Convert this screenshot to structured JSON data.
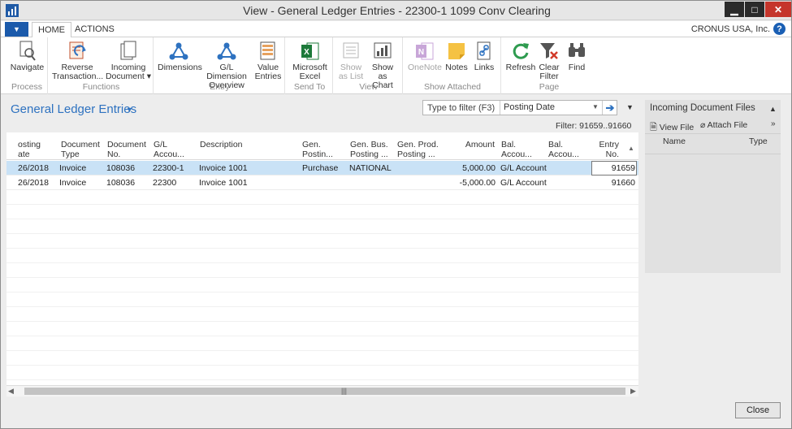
{
  "window": {
    "title": "View - General Ledger Entries - 22300-1 1099 Conv Clearing"
  },
  "tabs": [
    {
      "label": "HOME"
    },
    {
      "label": "ACTIONS"
    }
  ],
  "company": "CRONUS USA, Inc.",
  "ribbon": {
    "groups": [
      {
        "label": "Process",
        "buttons": [
          {
            "label1": "Navigate",
            "label2": "",
            "icon": "navigate-icon"
          }
        ]
      },
      {
        "label": "Functions",
        "buttons": [
          {
            "label1": "Reverse",
            "label2": "Transaction...",
            "icon": "reverse-transaction-icon"
          },
          {
            "label1": "Incoming",
            "label2": "Document ▾",
            "icon": "incoming-document-icon"
          }
        ]
      },
      {
        "label": "Entry",
        "buttons": [
          {
            "label1": "Dimensions",
            "label2": "",
            "icon": "dimensions-icon"
          },
          {
            "label1": "G/L Dimension",
            "label2": "Overview",
            "icon": "gl-dimension-overview-icon"
          },
          {
            "label1": "Value",
            "label2": "Entries",
            "icon": "value-entries-icon"
          }
        ]
      },
      {
        "label": "Send To",
        "buttons": [
          {
            "label1": "Microsoft",
            "label2": "Excel",
            "icon": "excel-icon"
          }
        ]
      },
      {
        "label": "View",
        "buttons": [
          {
            "label1": "Show",
            "label2": "as List",
            "icon": "show-as-list-icon"
          },
          {
            "label1": "Show as",
            "label2": "Chart",
            "icon": "show-as-chart-icon"
          }
        ]
      },
      {
        "label": "Show Attached",
        "buttons": [
          {
            "label1": "OneNote",
            "label2": "",
            "icon": "onenote-icon"
          },
          {
            "label1": "Notes",
            "label2": "",
            "icon": "notes-icon"
          },
          {
            "label1": "Links",
            "label2": "",
            "icon": "links-icon"
          }
        ]
      },
      {
        "label": "Page",
        "buttons": [
          {
            "label1": "Refresh",
            "label2": "",
            "icon": "refresh-icon"
          },
          {
            "label1": "Clear",
            "label2": "Filter",
            "icon": "clear-filter-icon"
          },
          {
            "label1": "Find",
            "label2": "",
            "icon": "find-icon"
          }
        ]
      }
    ]
  },
  "page": {
    "title": "General Ledger Entries",
    "filter": {
      "placeholder": "Type to filter (F3)",
      "field": "Posting Date",
      "summary": "Filter: 91659..91660"
    }
  },
  "grid": {
    "columns": [
      {
        "line1": "osting",
        "line2": "ate"
      },
      {
        "line1": "Document",
        "line2": "Type"
      },
      {
        "line1": "Document",
        "line2": "No."
      },
      {
        "line1": "G/L",
        "line2": "Accou..."
      },
      {
        "line1": "Description",
        "line2": ""
      },
      {
        "line1": "Gen.",
        "line2": "Postin..."
      },
      {
        "line1": "Gen. Bus.",
        "line2": "Posting ..."
      },
      {
        "line1": "Gen. Prod.",
        "line2": "Posting ..."
      },
      {
        "line1": "Amount",
        "line2": ""
      },
      {
        "line1": "Bal.",
        "line2": "Accou..."
      },
      {
        "line1": "Bal.",
        "line2": "Accou..."
      },
      {
        "line1": "Entry",
        "line2": "No."
      }
    ],
    "rows": [
      {
        "posting_date": "26/2018",
        "doc_type": "Invoice",
        "doc_no": "108036",
        "gl_account": "22300-1",
        "description": "Invoice 1001",
        "gen_posting": "Purchase",
        "gen_bus": "NATIONAL",
        "gen_prod": "",
        "amount": "5,000.00",
        "bal_type": "G/L Account",
        "bal_no": "",
        "entry_no": "91659"
      },
      {
        "posting_date": "26/2018",
        "doc_type": "Invoice",
        "doc_no": "108036",
        "gl_account": "22300",
        "description": "Invoice 1001",
        "gen_posting": "",
        "gen_bus": "",
        "gen_prod": "",
        "amount": "-5,000.00",
        "bal_type": "G/L Account",
        "bal_no": "",
        "entry_no": "91660"
      }
    ]
  },
  "factbox": {
    "title": "Incoming Document Files",
    "view_file": "View File",
    "attach_file": "Attach File",
    "col_name": "Name",
    "col_type": "Type"
  },
  "close_label": "Close",
  "colors": {
    "accent": "#1b5aab",
    "title_blue": "#2e72c0",
    "selection": "#c9e2f6",
    "close_red": "#c5352b"
  }
}
